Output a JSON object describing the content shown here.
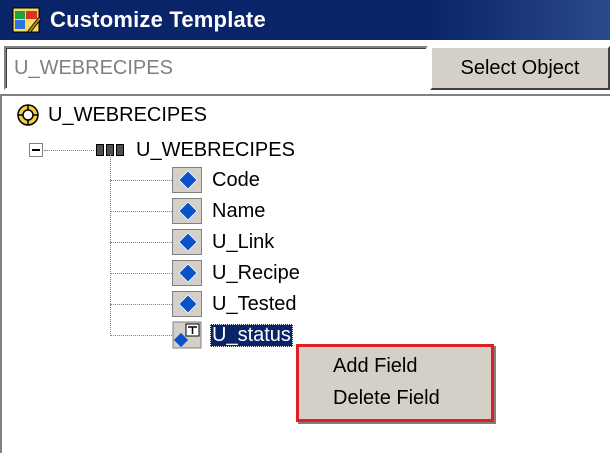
{
  "window": {
    "title": "Customize Template",
    "icon": "customize-template-icon"
  },
  "object": {
    "value": "U_WEBRECIPES",
    "select_label": "Select Object"
  },
  "tree": {
    "root_label": "U_WEBRECIPES",
    "root_icon": "database-icon",
    "table_label": "U_WEBRECIPES",
    "table_icon": "table-icon",
    "fields": [
      {
        "label": "Code",
        "icon": "field-icon"
      },
      {
        "label": "Name",
        "icon": "field-icon"
      },
      {
        "label": "U_Link",
        "icon": "field-icon"
      },
      {
        "label": "U_Recipe",
        "icon": "field-icon"
      },
      {
        "label": "U_Tested",
        "icon": "field-icon"
      },
      {
        "label": "U_status",
        "icon": "text-field-icon",
        "selected": true
      }
    ]
  },
  "context_menu": {
    "items": [
      "Add Field",
      "Delete Field"
    ],
    "highlight_color": "#e02020"
  },
  "colors": {
    "titlebar": "#0a246a",
    "selection": "#0a246a",
    "face": "#d4d0c8"
  }
}
